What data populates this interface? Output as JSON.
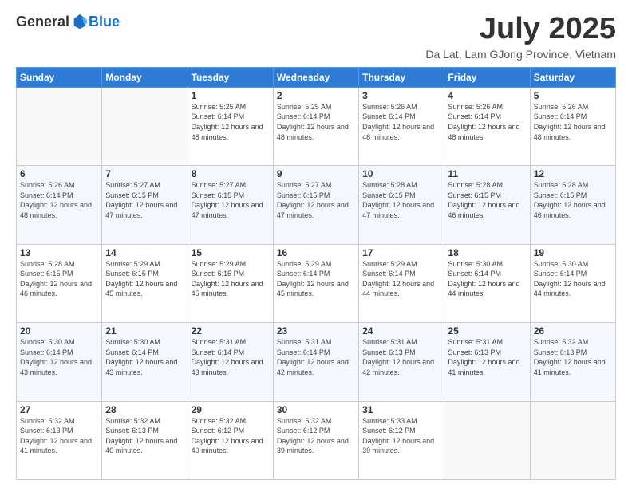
{
  "header": {
    "logo_general": "General",
    "logo_blue": "Blue",
    "month_title": "July 2025",
    "location": "Da Lat, Lam GJong Province, Vietnam"
  },
  "days_of_week": [
    "Sunday",
    "Monday",
    "Tuesday",
    "Wednesday",
    "Thursday",
    "Friday",
    "Saturday"
  ],
  "weeks": [
    [
      {
        "day": "",
        "info": ""
      },
      {
        "day": "",
        "info": ""
      },
      {
        "day": "1",
        "info": "Sunrise: 5:25 AM\nSunset: 6:14 PM\nDaylight: 12 hours and 48 minutes."
      },
      {
        "day": "2",
        "info": "Sunrise: 5:25 AM\nSunset: 6:14 PM\nDaylight: 12 hours and 48 minutes."
      },
      {
        "day": "3",
        "info": "Sunrise: 5:26 AM\nSunset: 6:14 PM\nDaylight: 12 hours and 48 minutes."
      },
      {
        "day": "4",
        "info": "Sunrise: 5:26 AM\nSunset: 6:14 PM\nDaylight: 12 hours and 48 minutes."
      },
      {
        "day": "5",
        "info": "Sunrise: 5:26 AM\nSunset: 6:14 PM\nDaylight: 12 hours and 48 minutes."
      }
    ],
    [
      {
        "day": "6",
        "info": "Sunrise: 5:26 AM\nSunset: 6:14 PM\nDaylight: 12 hours and 48 minutes."
      },
      {
        "day": "7",
        "info": "Sunrise: 5:27 AM\nSunset: 6:15 PM\nDaylight: 12 hours and 47 minutes."
      },
      {
        "day": "8",
        "info": "Sunrise: 5:27 AM\nSunset: 6:15 PM\nDaylight: 12 hours and 47 minutes."
      },
      {
        "day": "9",
        "info": "Sunrise: 5:27 AM\nSunset: 6:15 PM\nDaylight: 12 hours and 47 minutes."
      },
      {
        "day": "10",
        "info": "Sunrise: 5:28 AM\nSunset: 6:15 PM\nDaylight: 12 hours and 47 minutes."
      },
      {
        "day": "11",
        "info": "Sunrise: 5:28 AM\nSunset: 6:15 PM\nDaylight: 12 hours and 46 minutes."
      },
      {
        "day": "12",
        "info": "Sunrise: 5:28 AM\nSunset: 6:15 PM\nDaylight: 12 hours and 46 minutes."
      }
    ],
    [
      {
        "day": "13",
        "info": "Sunrise: 5:28 AM\nSunset: 6:15 PM\nDaylight: 12 hours and 46 minutes."
      },
      {
        "day": "14",
        "info": "Sunrise: 5:29 AM\nSunset: 6:15 PM\nDaylight: 12 hours and 45 minutes."
      },
      {
        "day": "15",
        "info": "Sunrise: 5:29 AM\nSunset: 6:15 PM\nDaylight: 12 hours and 45 minutes."
      },
      {
        "day": "16",
        "info": "Sunrise: 5:29 AM\nSunset: 6:14 PM\nDaylight: 12 hours and 45 minutes."
      },
      {
        "day": "17",
        "info": "Sunrise: 5:29 AM\nSunset: 6:14 PM\nDaylight: 12 hours and 44 minutes."
      },
      {
        "day": "18",
        "info": "Sunrise: 5:30 AM\nSunset: 6:14 PM\nDaylight: 12 hours and 44 minutes."
      },
      {
        "day": "19",
        "info": "Sunrise: 5:30 AM\nSunset: 6:14 PM\nDaylight: 12 hours and 44 minutes."
      }
    ],
    [
      {
        "day": "20",
        "info": "Sunrise: 5:30 AM\nSunset: 6:14 PM\nDaylight: 12 hours and 43 minutes."
      },
      {
        "day": "21",
        "info": "Sunrise: 5:30 AM\nSunset: 6:14 PM\nDaylight: 12 hours and 43 minutes."
      },
      {
        "day": "22",
        "info": "Sunrise: 5:31 AM\nSunset: 6:14 PM\nDaylight: 12 hours and 43 minutes."
      },
      {
        "day": "23",
        "info": "Sunrise: 5:31 AM\nSunset: 6:14 PM\nDaylight: 12 hours and 42 minutes."
      },
      {
        "day": "24",
        "info": "Sunrise: 5:31 AM\nSunset: 6:13 PM\nDaylight: 12 hours and 42 minutes."
      },
      {
        "day": "25",
        "info": "Sunrise: 5:31 AM\nSunset: 6:13 PM\nDaylight: 12 hours and 41 minutes."
      },
      {
        "day": "26",
        "info": "Sunrise: 5:32 AM\nSunset: 6:13 PM\nDaylight: 12 hours and 41 minutes."
      }
    ],
    [
      {
        "day": "27",
        "info": "Sunrise: 5:32 AM\nSunset: 6:13 PM\nDaylight: 12 hours and 41 minutes."
      },
      {
        "day": "28",
        "info": "Sunrise: 5:32 AM\nSunset: 6:13 PM\nDaylight: 12 hours and 40 minutes."
      },
      {
        "day": "29",
        "info": "Sunrise: 5:32 AM\nSunset: 6:12 PM\nDaylight: 12 hours and 40 minutes."
      },
      {
        "day": "30",
        "info": "Sunrise: 5:32 AM\nSunset: 6:12 PM\nDaylight: 12 hours and 39 minutes."
      },
      {
        "day": "31",
        "info": "Sunrise: 5:33 AM\nSunset: 6:12 PM\nDaylight: 12 hours and 39 minutes."
      },
      {
        "day": "",
        "info": ""
      },
      {
        "day": "",
        "info": ""
      }
    ]
  ]
}
